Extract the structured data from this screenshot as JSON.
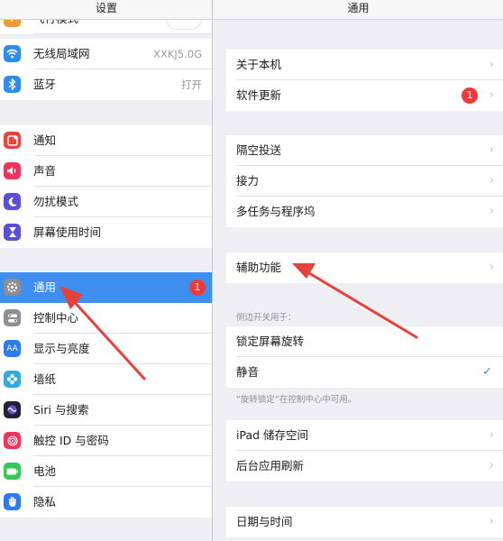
{
  "left": {
    "title": "设置",
    "partial_row_label": "飞行模式",
    "items": [
      {
        "label": "无线局域网",
        "value": "XXKJ5.0G",
        "icon": "wifi-icon",
        "color": "#2d8cf0"
      },
      {
        "label": "蓝牙",
        "value": "打开",
        "icon": "bluetooth-icon",
        "color": "#2d8cf0"
      },
      {
        "label": "通知",
        "icon": "notification-icon",
        "color": "#f0413b"
      },
      {
        "label": "声音",
        "icon": "speaker-icon",
        "color": "#f0345c"
      },
      {
        "label": "勿扰模式",
        "icon": "moon-icon",
        "color": "#5c4fd6"
      },
      {
        "label": "屏幕使用时间",
        "icon": "hourglass-icon",
        "color": "#5c4fd6"
      },
      {
        "label": "通用",
        "badge": "1",
        "icon": "gear-icon",
        "color": "#8e8e93"
      },
      {
        "label": "控制中心",
        "icon": "switches-icon",
        "color": "#8e8e93"
      },
      {
        "label": "显示与亮度",
        "icon": "text-size-icon",
        "color": "#2d7bf0"
      },
      {
        "label": "墙纸",
        "icon": "flower-icon",
        "color": "#35aadc"
      },
      {
        "label": "Siri 与搜索",
        "icon": "siri-icon",
        "color": "#222233"
      },
      {
        "label": "触控 ID 与密码",
        "icon": "fingerprint-icon",
        "color": "#f0345c"
      },
      {
        "label": "电池",
        "icon": "battery-icon",
        "color": "#34c759"
      },
      {
        "label": "隐私",
        "icon": "hand-icon",
        "color": "#2d7bf0"
      }
    ]
  },
  "right": {
    "title": "通用",
    "about": "关于本机",
    "software_update": "软件更新",
    "software_update_badge": "1",
    "airdrop": "隔空投送",
    "handoff": "接力",
    "multitasking": "多任务与程序坞",
    "accessibility": "辅助功能",
    "side_switch_header": "侧边开关用于：",
    "lock_rotation": "锁定屏幕旋转",
    "mute": "静音",
    "rotation_note": "“旋转锁定”在控制中心中可用。",
    "ipad_storage": "iPad 储存空间",
    "background_refresh": "后台应用刷新",
    "date_time": "日期与时间",
    "chevron": "›",
    "checkmark": "✓"
  },
  "colors": {
    "selected": "#3e8ff0",
    "badge": "#f03a3a",
    "arrow": "#e8413c"
  }
}
